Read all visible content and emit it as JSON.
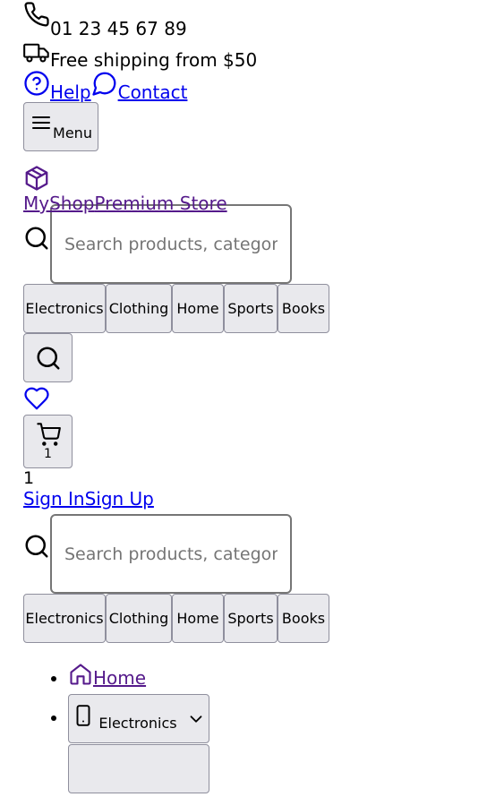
{
  "topbar": {
    "phone": "01 23 45 67 89",
    "shipping": "Free shipping from $50",
    "help": "Help",
    "contact": "Contact"
  },
  "menu_button": "Menu",
  "logo": {
    "name": "MyShop",
    "tagline": "Premium Store"
  },
  "search": {
    "placeholder": "Search products, categories..."
  },
  "categories": [
    "Electronics",
    "Clothing",
    "Home",
    "Sports",
    "Books"
  ],
  "cart": {
    "count": "1",
    "badge": "1"
  },
  "auth": {
    "sign_in": "Sign In",
    "sign_up": "Sign Up"
  },
  "nav": {
    "home": "Home",
    "electronics": "Electronics"
  },
  "colors": {
    "link": "#0000ee",
    "visited": "#551a8b",
    "button_bg": "#e9e9ed"
  }
}
